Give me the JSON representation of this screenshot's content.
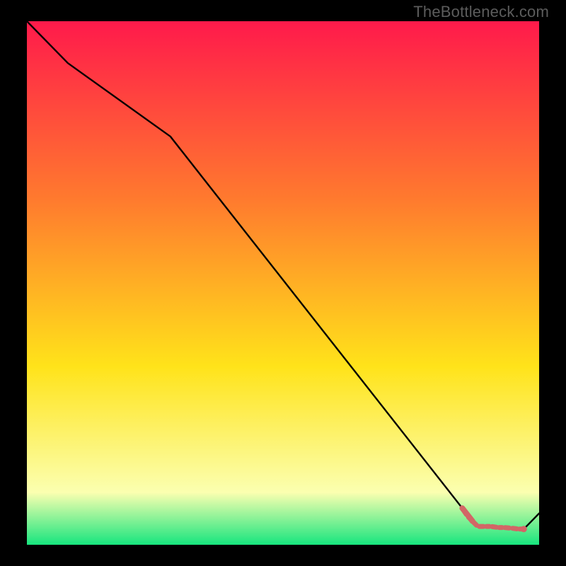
{
  "watermark": "TheBottleneck.com",
  "colors": {
    "gradient_top": "#ff1a4b",
    "gradient_mid1": "#ff7a2e",
    "gradient_mid2": "#ffe31a",
    "gradient_low": "#fbffb0",
    "gradient_bottom": "#17e57e",
    "line": "#000000",
    "marker": "#d26666"
  },
  "chart_data": {
    "type": "line",
    "title": "",
    "xlabel": "",
    "ylabel": "",
    "xlim": [
      0,
      100
    ],
    "ylim": [
      0,
      100
    ],
    "series": [
      {
        "name": "bottleneck-curve",
        "x": [
          0,
          8,
          28,
          85,
          88,
          97,
          100
        ],
        "y": [
          100,
          92,
          78,
          7,
          3.5,
          3,
          6
        ]
      }
    ],
    "markers": {
      "name": "bottleneck-band",
      "points": [
        {
          "x": 85.0,
          "y": 7.0
        },
        {
          "x": 86.0,
          "y": 5.5
        },
        {
          "x": 87.0,
          "y": 4.5
        },
        {
          "x": 88.0,
          "y": 3.5
        },
        {
          "x": 89.5,
          "y": 3.5
        },
        {
          "x": 90.5,
          "y": 3.5
        },
        {
          "x": 92.0,
          "y": 3.3
        },
        {
          "x": 93.0,
          "y": 3.3
        },
        {
          "x": 94.5,
          "y": 3.2
        },
        {
          "x": 96.0,
          "y": 3.0
        },
        {
          "x": 97.0,
          "y": 3.0
        }
      ]
    }
  }
}
